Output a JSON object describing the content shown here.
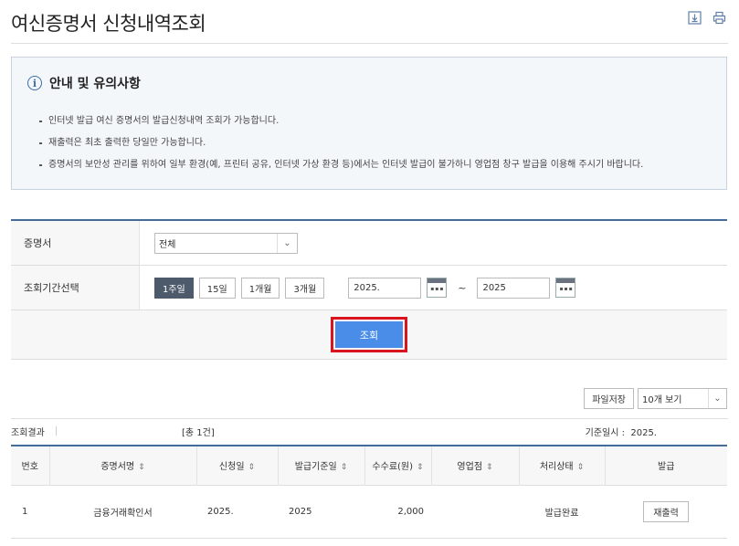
{
  "page_title": "여신증명서 신청내역조회",
  "top_icons": [
    "download-icon",
    "print-icon"
  ],
  "notice": {
    "heading": "안내 및 유의사항",
    "items": [
      "인터넷 발급 여신 증명서의 발급신청내역 조회가 가능합니다.",
      "재출력은 최초 출력한 당일만 가능합니다.",
      "증명서의 보안성 관리를 위하여 일부 환경(예, 프린터 공유, 인터넷 가상 환경 등)에서는 인터넷 발급이 불가하니 영업점 창구 발급을 이용해 주시기 바랍니다."
    ]
  },
  "form": {
    "certificate_label": "증명서",
    "certificate_value": "전체",
    "period_label": "조회기간선택",
    "period_buttons": [
      "1주일",
      "15일",
      "1개월",
      "3개월"
    ],
    "active_period": "1주일",
    "date_from": "2025.",
    "date_to": "2025",
    "tilde": "~",
    "search_label": "조회"
  },
  "toolbar": {
    "file_save": "파일저장",
    "page_size": "10개 보기"
  },
  "summary": {
    "label": "조회결과",
    "count": "[총 1건]",
    "base_label": "기준일시 :",
    "base_value": "2025."
  },
  "table": {
    "headers": [
      "번호",
      "증명서명",
      "신청일",
      "발급기준일",
      "수수료(원)",
      "영업점",
      "처리상태",
      "발급"
    ],
    "rows": [
      {
        "no": "1",
        "name": "금융거래확인서",
        "apply_date": "2025.",
        "base_date": "2025",
        "fee": "2,000",
        "branch": "",
        "status": "발급완료",
        "action": "재출력"
      }
    ]
  },
  "colors": {
    "accent_blue": "#4a8de8",
    "highlight_red": "#d9141f",
    "header_border": "#456b97",
    "active_period": "#4d5a6c"
  }
}
